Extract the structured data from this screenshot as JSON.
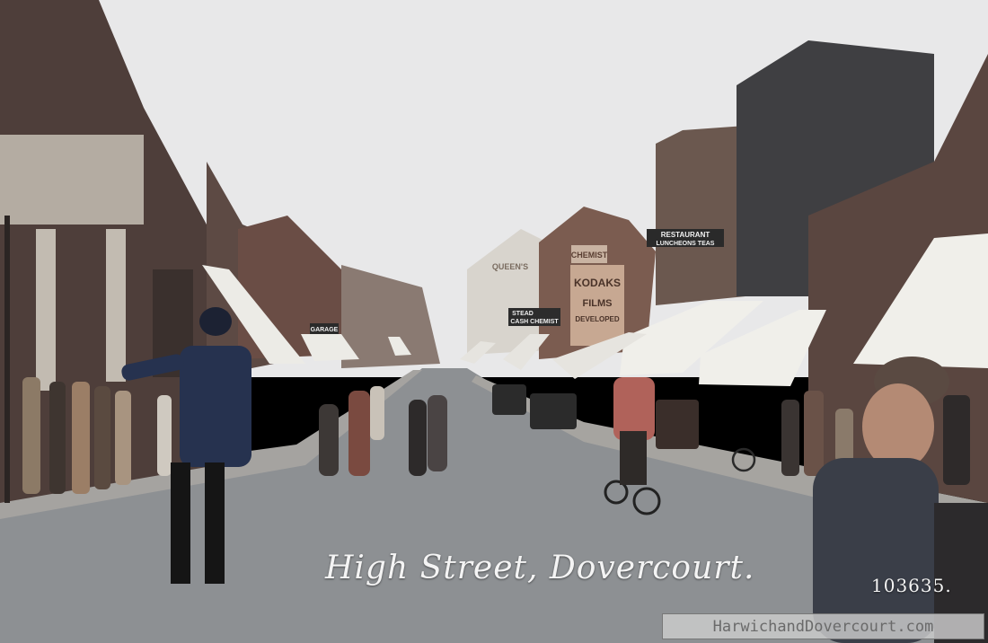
{
  "photo": {
    "caption": "High Street, Dovercourt.",
    "plate_number": "103635.",
    "watermark": "HarwichandDovercourt.com"
  },
  "shop_signs": {
    "restaurant": "RESTAURANT",
    "luncheons": "LUNCHEONS TEAS",
    "chemist": "CHEMIST",
    "kodaks": "KODAKS",
    "films": "FILMS",
    "developed": "DEVELOPED",
    "stead": "STEAD",
    "cash_chemist": "CASH CHEMIST",
    "garage": "GARAGE",
    "queens": "QUEEN'S"
  },
  "colors": {
    "sky": "#e9e9ea",
    "road": "#8c8f92",
    "brick": "#5a4640",
    "awning": "#efeeea",
    "sign_bg": "#2a2a2a"
  }
}
